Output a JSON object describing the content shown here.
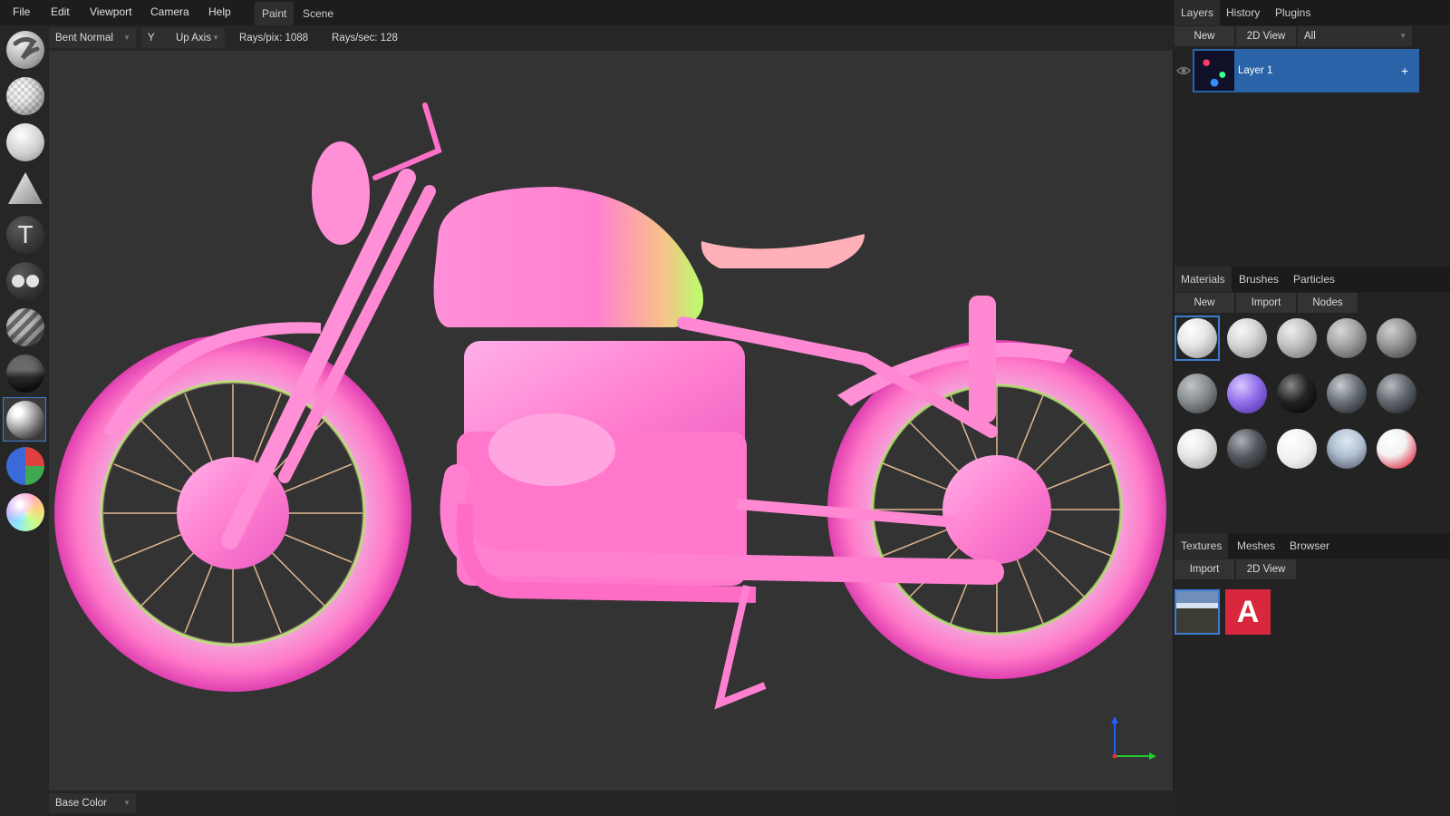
{
  "menu": [
    "File",
    "Edit",
    "Viewport",
    "Camera",
    "Help"
  ],
  "workspace_tabs": [
    "Paint",
    "Scene"
  ],
  "header": {
    "mode": "Bent Normal",
    "axis": "Y",
    "axis_label": "Up Axis",
    "rays_pix": "Rays/pix: 1088",
    "rays_sec": "Rays/sec: 128"
  },
  "tools": [
    {
      "name": "brush-tool",
      "icon": "brush-stroke-icon"
    },
    {
      "name": "eraser-tool",
      "icon": "checker-sphere-icon"
    },
    {
      "name": "fill-tool",
      "icon": "fill-sphere-icon"
    },
    {
      "name": "decal-tool",
      "icon": "triangle-icon"
    },
    {
      "name": "text-tool",
      "icon": "text-T-icon"
    },
    {
      "name": "clone-tool",
      "icon": "two-dots-icon"
    },
    {
      "name": "blur-tool",
      "icon": "stripes-sphere-icon"
    },
    {
      "name": "particle-tool",
      "icon": "grass-sphere-icon"
    },
    {
      "name": "bake-tool",
      "icon": "ao-sphere-icon"
    },
    {
      "name": "colorid-tool",
      "icon": "colorid-sphere-icon"
    },
    {
      "name": "picker-tool",
      "icon": "rainbow-sphere-icon"
    }
  ],
  "layers_panel": {
    "tabs": [
      "Layers",
      "History",
      "Plugins"
    ],
    "buttons": [
      "New",
      "2D View"
    ],
    "filter": "All",
    "layers": [
      {
        "name": "Layer 1",
        "add": "+"
      }
    ]
  },
  "materials_panel": {
    "tabs": [
      "Materials",
      "Brushes",
      "Particles"
    ],
    "buttons": [
      "New",
      "Import",
      "Nodes"
    ],
    "material_count": 15
  },
  "textures_panel": {
    "tabs": [
      "Textures",
      "Meshes",
      "Browser"
    ],
    "buttons": [
      "Import",
      "2D View"
    ],
    "textures": [
      "landscape-texture",
      "logo-texture"
    ],
    "logo_letter": "A"
  },
  "footer": {
    "channel": "Base Color"
  },
  "colors": {
    "accent": "#3e7bd0",
    "selected_layer": "#2a63a8",
    "viewport_bg": "#333333",
    "model_pink": "#ff6ec8",
    "model_green": "#a8ff5a"
  }
}
